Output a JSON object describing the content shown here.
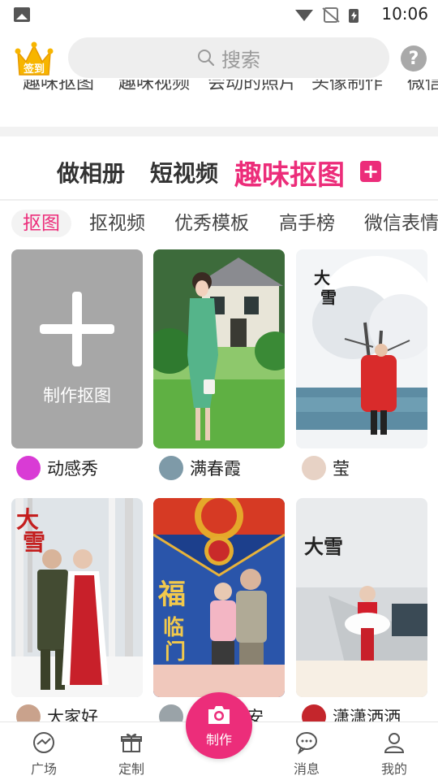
{
  "status_bar": {
    "time": "10:06"
  },
  "header": {
    "checkin_label": "签到",
    "search_placeholder": "搜索",
    "help_label": "?"
  },
  "categories": [
    "趣味抠图",
    "趣味视频",
    "会动的照片",
    "头像制作",
    "微信"
  ],
  "main_tabs": [
    {
      "label": "做相册"
    },
    {
      "label": "短视频"
    },
    {
      "label": "趣味抠图",
      "active": true
    }
  ],
  "add_tab_label": "+",
  "sub_tabs": [
    {
      "label": "抠图",
      "active": true
    },
    {
      "label": "抠视频"
    },
    {
      "label": "优秀模板"
    },
    {
      "label": "高手榜"
    },
    {
      "label": "微信表情"
    }
  ],
  "make_card": {
    "label": "制作抠图"
  },
  "posts": [
    {
      "author": "动感秀",
      "image": "woman-garden-photo"
    },
    {
      "author": "满春霞",
      "image": "snow-tree-photo"
    },
    {
      "author": "莹",
      "image": ""
    },
    {
      "author": "大家好",
      "image": "snow-couple-photo"
    },
    {
      "author": "安",
      "image": "fu-card-couple-photo"
    },
    {
      "author": "潇潇洒洒",
      "image": "snow-street-woman-photo"
    }
  ],
  "bottom_nav": [
    {
      "label": "广场",
      "icon": "plaza-icon"
    },
    {
      "label": "定制",
      "icon": "gift-icon"
    },
    {
      "label": "制作",
      "icon": "camera-icon"
    },
    {
      "label": "消息",
      "icon": "message-icon"
    },
    {
      "label": "我的",
      "icon": "profile-icon"
    }
  ],
  "colors": {
    "accent": "#ec2d7a",
    "make_card_bg": "#a7a7a7"
  }
}
